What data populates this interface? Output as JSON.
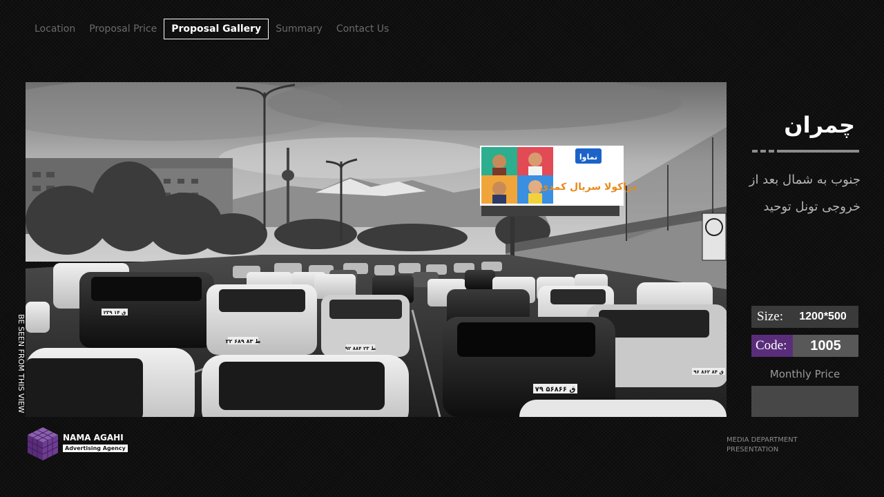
{
  "nav": {
    "items": [
      {
        "label": "Location",
        "active": false
      },
      {
        "label": "Proposal Price",
        "active": false
      },
      {
        "label": "Proposal Gallery",
        "active": true
      },
      {
        "label": "Summary",
        "active": false
      },
      {
        "label": "Contact Us",
        "active": false
      }
    ]
  },
  "gallery": {
    "vertical_caption": "BE SEEN FROM THIS VIEW",
    "billboard": {
      "brand": "نماوا",
      "title": "دراکولا سریال کمدی"
    },
    "plates": [
      "۷۹ ق ۵۶۸۶۶",
      "۲۲ ۶۸۹ ط ۸۳",
      "۹۲ ۸۸۴ ط ۲۳",
      "۲۳۹ ق ۱۴",
      "۹۶ ۸۶۲ ق ۸۴"
    ]
  },
  "location": {
    "title": "چمران",
    "description": "جنوب به شمال بعد از خروجی تونل توحید"
  },
  "specs": {
    "size_label": "Size:",
    "size_value": "1200*500",
    "code_label": "Code:",
    "code_value": "1005",
    "monthly_price_label": "Monthly Price",
    "monthly_price_value": ""
  },
  "footer": {
    "company_name": "NAMA AGAHI",
    "company_tagline": "Advertising Agency",
    "note_line1": "MEDIA DEPARTMENT",
    "note_line2": "PRESENTATION"
  },
  "colors": {
    "background": "#0d0d0d",
    "accent_purple": "#5a2d7a",
    "panel_gray": "#3a3a3a"
  }
}
